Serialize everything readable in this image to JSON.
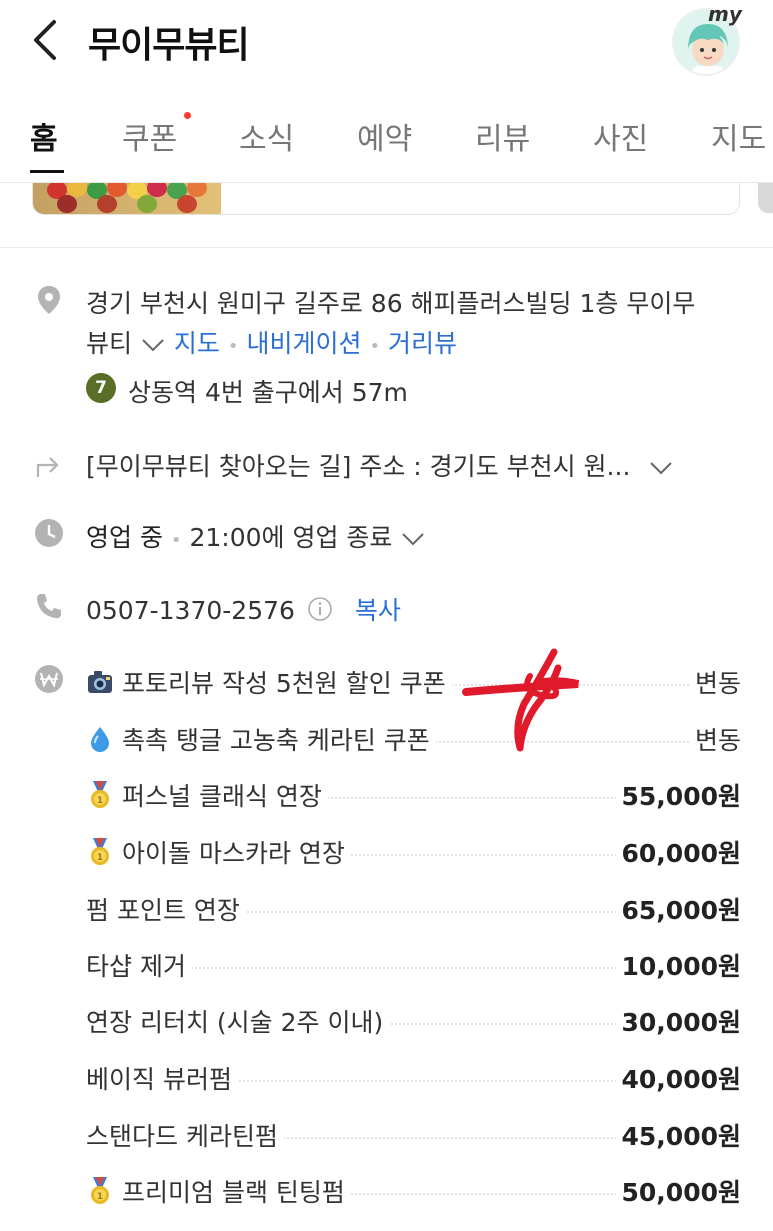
{
  "header": {
    "title": "무이무뷰티",
    "profile_text": "my"
  },
  "tabs": [
    {
      "label": "홈",
      "active": true
    },
    {
      "label": "쿠폰",
      "badge": true
    },
    {
      "label": "소식"
    },
    {
      "label": "예약"
    },
    {
      "label": "리뷰"
    },
    {
      "label": "사진"
    },
    {
      "label": "지도"
    }
  ],
  "info": {
    "address_line1": "경기 부천시 원미구 길주로 86 해피플러스빌딩 1층 무이무",
    "address_line2": "뷰티",
    "map_link": "지도",
    "navigation_link": "내비게이션",
    "streetview_link": "거리뷰",
    "subway_line": "7",
    "subway_text": "상동역 4번 출구에서 57m",
    "directions": "[무이무뷰티 찾아오는 길] 주소 : 경기도 부천시 원...",
    "hours_status": "영업 중",
    "hours_detail": "21:00에 영업 종료",
    "phone": "0507-1370-2576",
    "copy_label": "복사"
  },
  "menu": [
    {
      "emoji": "camera",
      "name": "포토리뷰 작성 5천원 할인 쿠폰",
      "price": "변동"
    },
    {
      "emoji": "droplet",
      "name": "촉촉 탱글 고농축 케라틴 쿠폰",
      "price": "변동"
    },
    {
      "emoji": "medal",
      "name": "퍼스널 클래식 연장",
      "price": "55,000원"
    },
    {
      "emoji": "medal",
      "name": "아이돌 마스카라 연장",
      "price": "60,000원"
    },
    {
      "emoji": "",
      "name": "펌 포인트 연장",
      "price": "65,000원"
    },
    {
      "emoji": "",
      "name": "타샵 제거",
      "price": "10,000원"
    },
    {
      "emoji": "",
      "name": "연장 리터치 (시술 2주 이내)",
      "price": "30,000원"
    },
    {
      "emoji": "",
      "name": "베이직 뷰러펌",
      "price": "40,000원"
    },
    {
      "emoji": "",
      "name": "스탠다드 케라틴펌",
      "price": "45,000원"
    },
    {
      "emoji": "medal",
      "name": "프리미엄 블랙 틴팅펌",
      "price": "50,000원"
    }
  ],
  "colors": {
    "link": "#2b6fd4",
    "subway_line7": "#5b6e27",
    "annotation": "#e0192b"
  }
}
